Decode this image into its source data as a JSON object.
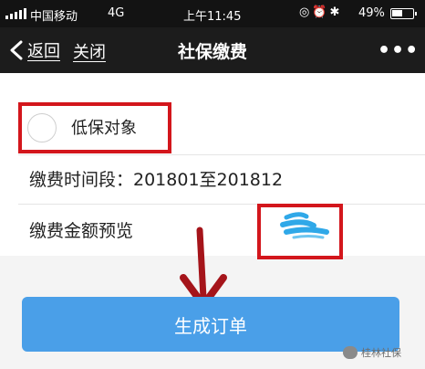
{
  "status_bar": {
    "carrier": "中国移动",
    "network": "4G",
    "time": "上午11:45",
    "battery_percent": "49%"
  },
  "nav": {
    "back_label": "返回",
    "close_label": "关闭",
    "title": "社保缴费",
    "more_label": "•••"
  },
  "form": {
    "subsidy_option_label": "低保对象",
    "subsidy_option_checked": false,
    "period_label": "缴费时间段：201801至201812",
    "amount_label": "缴费金额预览"
  },
  "actions": {
    "generate_order_label": "生成订单"
  },
  "watermark": {
    "text": "桂林社保"
  },
  "colors": {
    "accent_button": "#4a9fe8",
    "annotation_red": "#d3161c",
    "nav_background": "#1c1c1c",
    "redaction_blue": "#2fa8e8"
  }
}
